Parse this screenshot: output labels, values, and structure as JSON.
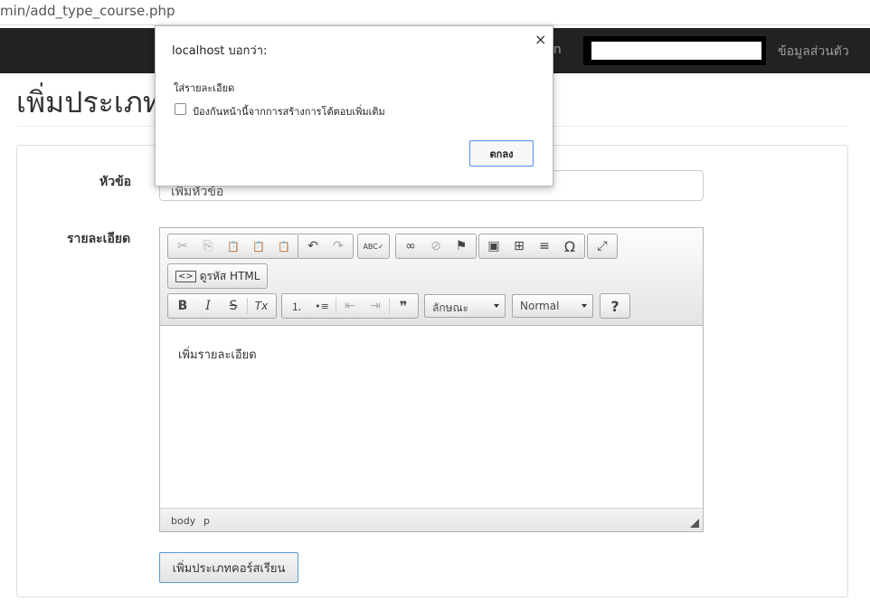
{
  "browser": {
    "url": "min/add_type_course.php"
  },
  "navbar": {
    "partial_text": "in",
    "profile_label": "ข้อมูลส่วนตัว"
  },
  "page": {
    "title": "เพิ่มประเภท"
  },
  "form": {
    "topic_label": "หัวข้อ",
    "topic_value": "เพิ่มหัวข้อ",
    "detail_label": "รายละเอียด",
    "submit_label": "เพิ่มประเภทคอร์สเรียน"
  },
  "editor": {
    "source_label": "ดูรหัส HTML",
    "styles_label": "ลักษณะ",
    "format_label": "Normal",
    "content": "เพิ่มรายละเอียด",
    "path": [
      "body",
      "p"
    ],
    "icons": {
      "cut": "✂",
      "copy": "⎘",
      "paste": "📋",
      "undo": "↶",
      "redo": "↷",
      "spell": "ABC✓",
      "link": "∞",
      "unlink": "⊘",
      "anchor": "⚑",
      "image": "▣",
      "table": "⊞",
      "hr": "≡",
      "special": "Ω",
      "maximize": "⤢",
      "bold": "B",
      "italic": "I",
      "strike": "S",
      "clear": "Tx",
      "numlist": "⒈",
      "bullist": "•≡",
      "outdent": "⇤",
      "indent": "⇥",
      "quote": "❞",
      "help": "?"
    }
  },
  "dialog": {
    "title": "localhost บอกว่า:",
    "message": "ใส่รายละเอียด",
    "checkbox_label": "ป้องกันหน้านี้จากการสร้างการโต้ตอบเพิ่มเติม",
    "ok_label": "ตกลง",
    "close_symbol": "×"
  }
}
